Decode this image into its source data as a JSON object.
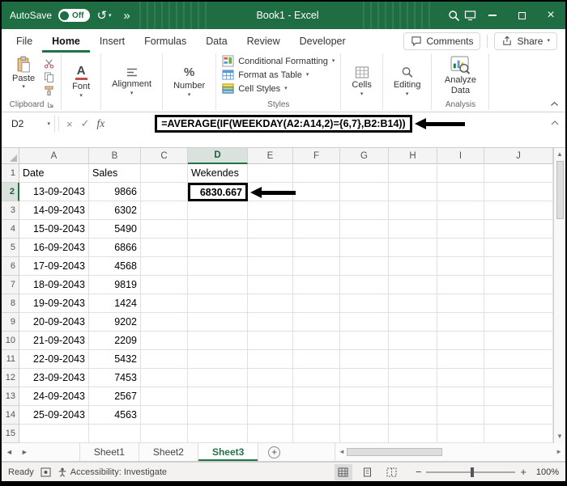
{
  "titlebar": {
    "autosave_label": "AutoSave",
    "autosave_state": "Off",
    "title": "Book1 - Excel"
  },
  "ribbon_tabs": {
    "items": [
      "File",
      "Home",
      "Insert",
      "Formulas",
      "Data",
      "Review",
      "Developer"
    ],
    "active": "Home",
    "comments_label": "Comments",
    "share_label": "Share"
  },
  "ribbon": {
    "paste_label": "Paste",
    "font_label": "Font",
    "alignment_label": "Alignment",
    "number_label": "Number",
    "conditional_formatting_label": "Conditional Formatting",
    "format_as_table_label": "Format as Table",
    "cell_styles_label": "Cell Styles",
    "cells_label": "Cells",
    "editing_label": "Editing",
    "analyze_data_label": "Analyze Data",
    "clipboard_group_label": "Clipboard",
    "styles_group_label": "Styles",
    "analysis_group_label": "Analysis"
  },
  "formula_bar": {
    "name_box_value": "D2",
    "fx_label": "fx",
    "formula": "=AVERAGE(IF(WEEKDAY(A2:A14,2)={6,7},B2:B14))"
  },
  "sheet": {
    "columns": [
      "A",
      "B",
      "C",
      "D",
      "E",
      "F",
      "G",
      "H",
      "I",
      "J"
    ],
    "selected_column": "D",
    "selected_row": 2,
    "annotated_cell": "D2",
    "rows": [
      {
        "n": 1,
        "cells": {
          "A": "Date",
          "B": "Sales",
          "D": "Wekendes"
        }
      },
      {
        "n": 2,
        "cells": {
          "A": "13-09-2043",
          "B": "9866",
          "D": "6830.667"
        }
      },
      {
        "n": 3,
        "cells": {
          "A": "14-09-2043",
          "B": "6302"
        }
      },
      {
        "n": 4,
        "cells": {
          "A": "15-09-2043",
          "B": "5490"
        }
      },
      {
        "n": 5,
        "cells": {
          "A": "16-09-2043",
          "B": "6866"
        }
      },
      {
        "n": 6,
        "cells": {
          "A": "17-09-2043",
          "B": "4568"
        }
      },
      {
        "n": 7,
        "cells": {
          "A": "18-09-2043",
          "B": "9819"
        }
      },
      {
        "n": 8,
        "cells": {
          "A": "19-09-2043",
          "B": "1424"
        }
      },
      {
        "n": 9,
        "cells": {
          "A": "20-09-2043",
          "B": "9202"
        }
      },
      {
        "n": 10,
        "cells": {
          "A": "21-09-2043",
          "B": "2209"
        }
      },
      {
        "n": 11,
        "cells": {
          "A": "22-09-2043",
          "B": "5432"
        }
      },
      {
        "n": 12,
        "cells": {
          "A": "23-09-2043",
          "B": "7453"
        }
      },
      {
        "n": 13,
        "cells": {
          "A": "24-09-2043",
          "B": "2567"
        }
      },
      {
        "n": 14,
        "cells": {
          "A": "25-09-2043",
          "B": "4563"
        }
      },
      {
        "n": 15,
        "cells": {}
      }
    ]
  },
  "sheet_tabs": {
    "tabs": [
      "Sheet1",
      "Sheet2",
      "Sheet3"
    ],
    "active": "Sheet3"
  },
  "status_bar": {
    "mode": "Ready",
    "accessibility": "Accessibility: Investigate",
    "zoom": "100%"
  },
  "colors": {
    "excel_green": "#217346",
    "titlebar_green": "#1f6e43",
    "annotation_black": "#000000"
  }
}
